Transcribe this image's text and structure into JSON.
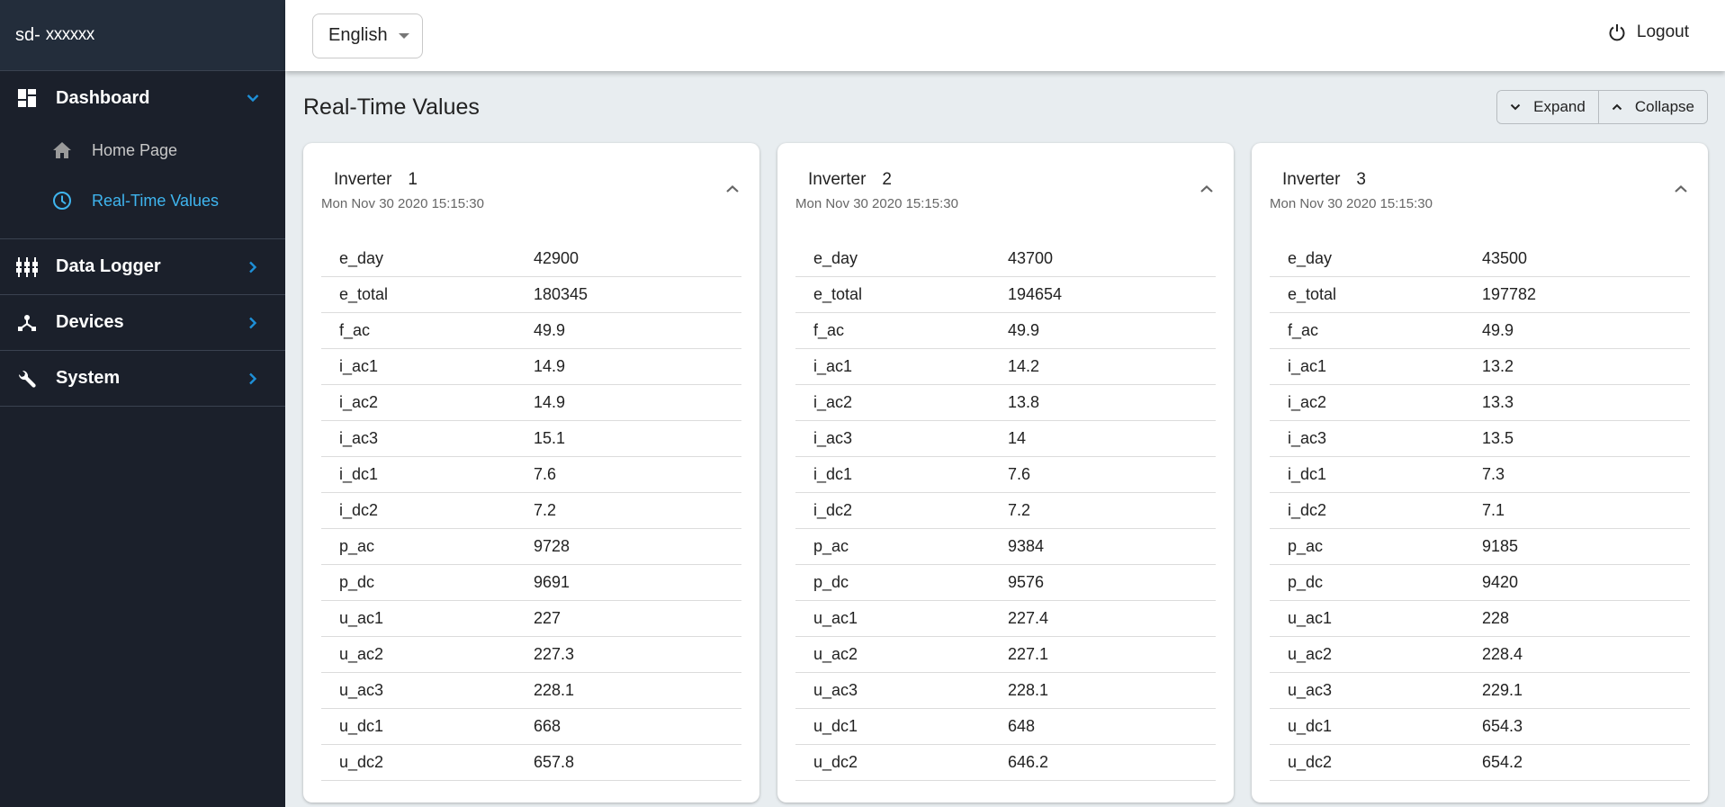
{
  "sidebar": {
    "brand_prefix": "sd-",
    "brand_name": "xxxxxx",
    "groups": [
      {
        "label": "Dashboard",
        "icon": "dashboard-icon",
        "expanded": true,
        "items": [
          {
            "label": "Home Page",
            "icon": "home-icon",
            "active": false
          },
          {
            "label": "Real-Time Values",
            "icon": "clock-icon",
            "active": true
          }
        ]
      },
      {
        "label": "Data Logger",
        "icon": "data-logger-icon",
        "expanded": false
      },
      {
        "label": "Devices",
        "icon": "devices-icon",
        "expanded": false
      },
      {
        "label": "System",
        "icon": "wrench-icon",
        "expanded": false
      }
    ]
  },
  "topbar": {
    "language": "English",
    "logout_label": "Logout"
  },
  "main": {
    "title": "Real-Time Values",
    "expand_label": "Expand",
    "collapse_label": "Collapse",
    "cards": [
      {
        "title": "Inverter",
        "number": "1",
        "timestamp": "Mon Nov 30 2020 15:15:30",
        "rows": [
          {
            "key": "e_day",
            "value": "42900"
          },
          {
            "key": "e_total",
            "value": "180345"
          },
          {
            "key": "f_ac",
            "value": "49.9"
          },
          {
            "key": "i_ac1",
            "value": "14.9"
          },
          {
            "key": "i_ac2",
            "value": "14.9"
          },
          {
            "key": "i_ac3",
            "value": "15.1"
          },
          {
            "key": "i_dc1",
            "value": "7.6"
          },
          {
            "key": "i_dc2",
            "value": "7.2"
          },
          {
            "key": "p_ac",
            "value": "9728"
          },
          {
            "key": "p_dc",
            "value": "9691"
          },
          {
            "key": "u_ac1",
            "value": "227"
          },
          {
            "key": "u_ac2",
            "value": "227.3"
          },
          {
            "key": "u_ac3",
            "value": "228.1"
          },
          {
            "key": "u_dc1",
            "value": "668"
          },
          {
            "key": "u_dc2",
            "value": "657.8"
          }
        ]
      },
      {
        "title": "Inverter",
        "number": "2",
        "timestamp": "Mon Nov 30 2020 15:15:30",
        "rows": [
          {
            "key": "e_day",
            "value": "43700"
          },
          {
            "key": "e_total",
            "value": "194654"
          },
          {
            "key": "f_ac",
            "value": "49.9"
          },
          {
            "key": "i_ac1",
            "value": "14.2"
          },
          {
            "key": "i_ac2",
            "value": "13.8"
          },
          {
            "key": "i_ac3",
            "value": "14"
          },
          {
            "key": "i_dc1",
            "value": "7.6"
          },
          {
            "key": "i_dc2",
            "value": "7.2"
          },
          {
            "key": "p_ac",
            "value": "9384"
          },
          {
            "key": "p_dc",
            "value": "9576"
          },
          {
            "key": "u_ac1",
            "value": "227.4"
          },
          {
            "key": "u_ac2",
            "value": "227.1"
          },
          {
            "key": "u_ac3",
            "value": "228.1"
          },
          {
            "key": "u_dc1",
            "value": "648"
          },
          {
            "key": "u_dc2",
            "value": "646.2"
          }
        ]
      },
      {
        "title": "Inverter",
        "number": "3",
        "timestamp": "Mon Nov 30 2020 15:15:30",
        "rows": [
          {
            "key": "e_day",
            "value": "43500"
          },
          {
            "key": "e_total",
            "value": "197782"
          },
          {
            "key": "f_ac",
            "value": "49.9"
          },
          {
            "key": "i_ac1",
            "value": "13.2"
          },
          {
            "key": "i_ac2",
            "value": "13.3"
          },
          {
            "key": "i_ac3",
            "value": "13.5"
          },
          {
            "key": "i_dc1",
            "value": "7.3"
          },
          {
            "key": "i_dc2",
            "value": "7.1"
          },
          {
            "key": "p_ac",
            "value": "9185"
          },
          {
            "key": "p_dc",
            "value": "9420"
          },
          {
            "key": "u_ac1",
            "value": "228"
          },
          {
            "key": "u_ac2",
            "value": "228.4"
          },
          {
            "key": "u_ac3",
            "value": "229.1"
          },
          {
            "key": "u_dc1",
            "value": "654.3"
          },
          {
            "key": "u_dc2",
            "value": "654.2"
          }
        ]
      }
    ]
  },
  "colors": {
    "sidebar_bg": "#1b202b",
    "sidebar_header_bg": "#232d3b",
    "accent": "#3fb5ef",
    "chevron": "#1e90d8",
    "page_bg": "#e8edf0"
  }
}
